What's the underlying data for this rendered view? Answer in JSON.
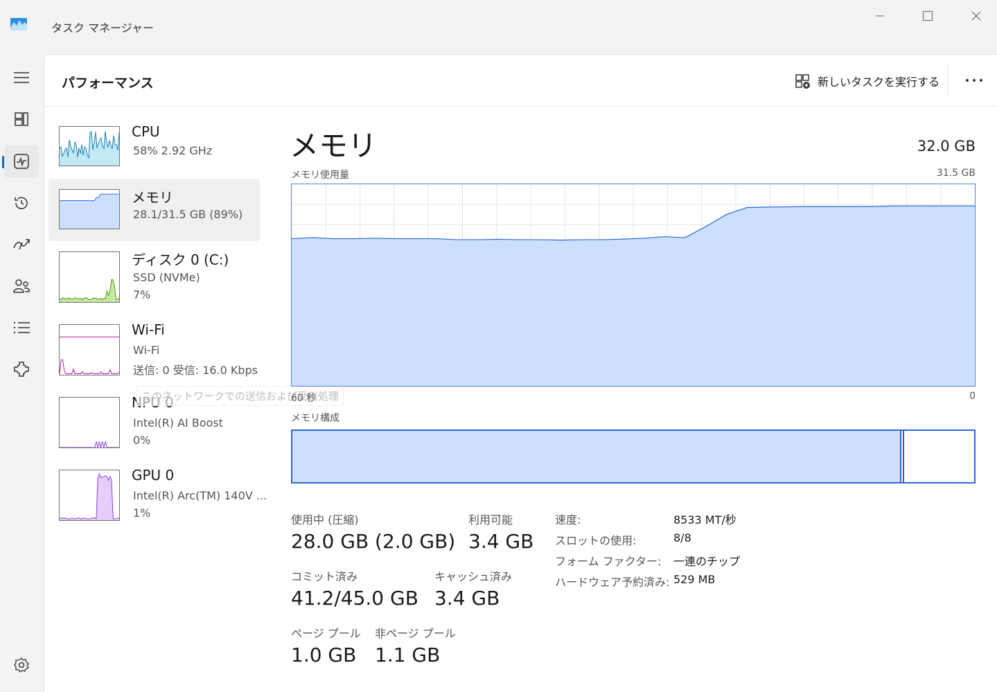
{
  "window": {
    "title": "タスク マネージャー"
  },
  "nav": [
    {
      "name": "hamburger-menu-icon"
    },
    {
      "name": "processes-icon"
    },
    {
      "name": "performance-icon",
      "active": true
    },
    {
      "name": "app-history-icon"
    },
    {
      "name": "startup-apps-icon"
    },
    {
      "name": "users-icon"
    },
    {
      "name": "details-icon"
    },
    {
      "name": "services-icon"
    },
    {
      "name": "settings-icon"
    }
  ],
  "header": {
    "title": "パフォーマンス",
    "new_task_label": "新しいタスクを実行する"
  },
  "resources": [
    {
      "name": "CPU",
      "line1": "58%  2.92 GHz",
      "line2": ""
    },
    {
      "name": "メモリ",
      "line1": "28.1/31.5 GB (89%)",
      "line2": ""
    },
    {
      "name": "ディスク 0 (C:)",
      "line1": "SSD (NVMe)",
      "line2": "7%"
    },
    {
      "name": "Wi-Fi",
      "line1": "Wi-Fi",
      "line2": "送信: 0  受信: 16.0 Kbps"
    },
    {
      "name": "NPU 0",
      "line1": "Intel(R) AI Boost",
      "line2": "0%"
    },
    {
      "name": "GPU 0",
      "line1": "Intel(R) Arc(TM) 140V ...",
      "line2": "1%"
    }
  ],
  "tooltip": "このネットワークでの送信および受信処理",
  "detail": {
    "title": "メモリ",
    "total": "32.0 GB",
    "usage_label": "メモリ使用量",
    "usage_max": "31.5 GB",
    "x_left": "60 秒",
    "x_right": "0",
    "composition_label": "メモリ構成",
    "composition_used_fraction": 0.893,
    "composition_standby_fraction": 0.002
  },
  "usage_history_fraction": [
    0.73,
    0.735,
    0.73,
    0.73,
    0.732,
    0.73,
    0.73,
    0.73,
    0.725,
    0.725,
    0.727,
    0.725,
    0.725,
    0.723,
    0.725,
    0.725,
    0.728,
    0.732,
    0.74,
    0.735,
    0.79,
    0.85,
    0.885,
    0.887,
    0.888,
    0.889,
    0.889,
    0.889,
    0.89,
    0.892,
    0.893,
    0.892,
    0.893,
    0.892
  ],
  "stats": {
    "in_use_label": "使用中 (圧縮)",
    "in_use_value": "28.0 GB (2.0 GB)",
    "available_label": "利用可能",
    "available_value": "3.4 GB",
    "committed_label": "コミット済み",
    "committed_value": "41.2/45.0 GB",
    "cached_label": "キャッシュ済み",
    "cached_value": "3.4 GB",
    "paged_label": "ページ プール",
    "paged_value": "1.0 GB",
    "nonpaged_label": "非ページ プール",
    "nonpaged_value": "1.1 GB"
  },
  "specs": [
    {
      "label": "速度:",
      "value": "8533 MT/秒"
    },
    {
      "label": "スロットの使用:",
      "value": "8/8"
    },
    {
      "label": "フォーム ファクター:",
      "value": "一連のチップ"
    },
    {
      "label": "ハードウェア予約済み:",
      "value": "529 MB"
    }
  ],
  "colors": {
    "memory_fill": "#cce0fb",
    "memory_line": "#2b66d9",
    "cpu_fill": "#c2eaf5",
    "cpu_line": "#1a7dad",
    "disk_fill": "#c7e8a4",
    "disk_line": "#4e9a06",
    "wifi_line": "#b5179e",
    "npu_line": "#8a3ed8",
    "gpu_fill": "#e6cdfb",
    "gpu_line": "#8a3ed8"
  }
}
